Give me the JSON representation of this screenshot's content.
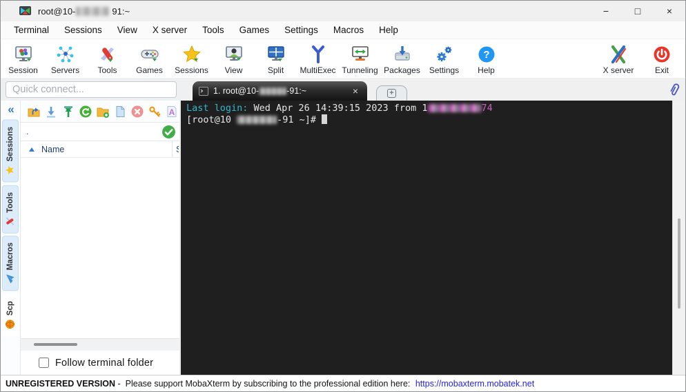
{
  "window": {
    "title_prefix": "root@10-",
    "title_suffix": "91:~",
    "logo_icon": "mobaxterm-logo",
    "controls": {
      "minimize": "−",
      "maximize": "□",
      "close": "×"
    }
  },
  "menubar": {
    "items": [
      "Terminal",
      "Sessions",
      "View",
      "X server",
      "Tools",
      "Games",
      "Settings",
      "Macros",
      "Help"
    ]
  },
  "toolbar": {
    "items": [
      {
        "label": "Session",
        "icon": "session-icon"
      },
      {
        "label": "Servers",
        "icon": "servers-icon"
      },
      {
        "label": "Tools",
        "icon": "tools-icon"
      },
      {
        "label": "Games",
        "icon": "games-icon"
      },
      {
        "label": "Sessions",
        "icon": "sessions-star-icon"
      },
      {
        "label": "View",
        "icon": "view-icon"
      },
      {
        "label": "Split",
        "icon": "split-icon"
      },
      {
        "label": "MultiExec",
        "icon": "multiexec-icon"
      },
      {
        "label": "Tunneling",
        "icon": "tunneling-icon"
      },
      {
        "label": "Packages",
        "icon": "packages-icon"
      },
      {
        "label": "Settings",
        "icon": "settings-gear-icon"
      },
      {
        "label": "Help",
        "icon": "help-icon"
      },
      {
        "label": "X server",
        "icon": "xserver-icon"
      },
      {
        "label": "Exit",
        "icon": "exit-power-icon"
      }
    ]
  },
  "quick_connect": {
    "placeholder": "Quick connect..."
  },
  "tabbar": {
    "active_tab": {
      "prefix": "1. root@10-",
      "suffix": "-91:~",
      "icon": "terminal-tab-icon",
      "close_icon": "close-icon"
    },
    "new_tab_icon": "plus-icon",
    "attach_icon": "paperclip-icon"
  },
  "sidebar": {
    "collapse_label": "«",
    "tabs": [
      {
        "label": "Sessions",
        "icon": "star-icon"
      },
      {
        "label": "Tools",
        "icon": "swiss-knife-icon"
      },
      {
        "label": "Macros",
        "icon": "paper-plane-icon"
      },
      {
        "label": "Scp",
        "icon": "globe-icon",
        "active": true
      }
    ]
  },
  "sftp": {
    "toolbar_icons": [
      "folder-up-icon",
      "download-icon",
      "upload-icon",
      "refresh-icon",
      "new-folder-icon",
      "new-file-icon",
      "delete-icon",
      "key-permissions-icon",
      "edit-font-icon"
    ],
    "path_value": ".",
    "path_ok_icon": "check-circle-icon",
    "columns": [
      "Name",
      "S"
    ],
    "follow_label": "Follow terminal folder"
  },
  "terminal": {
    "line1": {
      "label": "Last login:",
      "body": " Wed Apr 26 14:39:15 2023 from 1",
      "suffix": "74"
    },
    "line2": {
      "prefix": "[root@10 ",
      "suffix": "-91 ~]# "
    },
    "colors": {
      "background": "#1f1f1f",
      "foreground": "#e6e6e6",
      "cyan": "#32b8cc",
      "magenta": "#c95fc0"
    }
  },
  "statusbar": {
    "bold": "UNREGISTERED VERSION",
    "text": " -  Please support MobaXterm by subscribing to the professional edition here: ",
    "link": "https://mobaxterm.mobatek.net"
  }
}
